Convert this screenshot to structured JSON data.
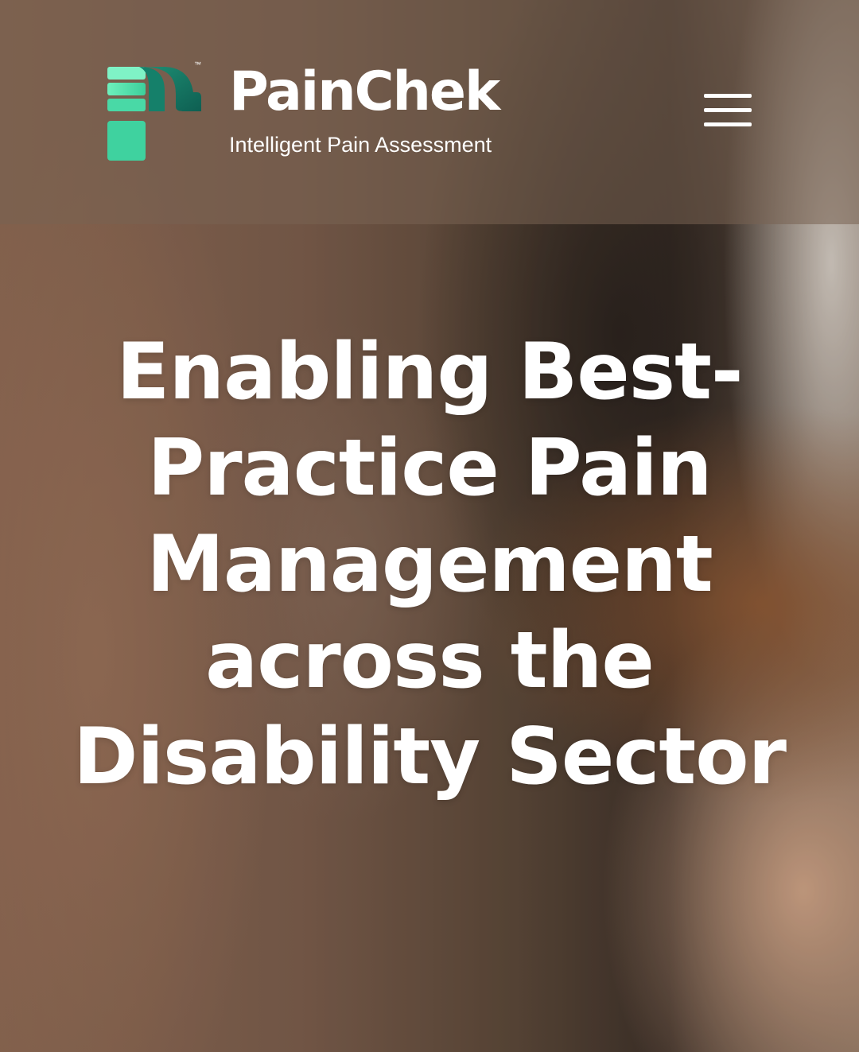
{
  "header": {
    "brand": {
      "name": "PainChek",
      "trademark": "™",
      "tagline": "Intelligent Pain Assessment",
      "colors": {
        "mark_light": "#5ee6b0",
        "mark_mid": "#2fbf8f",
        "mark_dark": "#0f6b5a"
      }
    },
    "menu": {
      "icon": "hamburger-menu-icon",
      "label": "Menu"
    }
  },
  "hero": {
    "title": "Enabling Best-Practice Pain Management across the Disability Sector",
    "background": "photo-of-smiling-person"
  }
}
